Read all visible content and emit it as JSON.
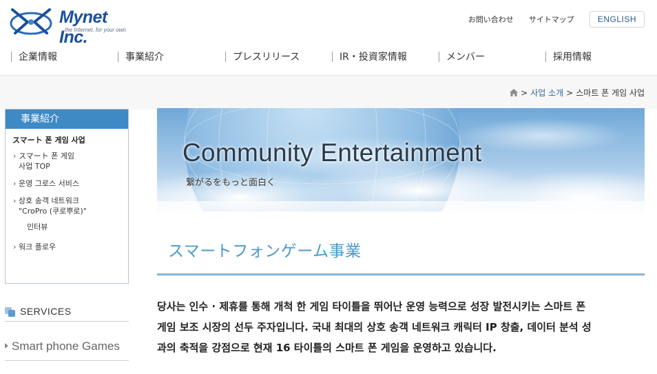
{
  "header": {
    "logo_name": "Mynet Inc.",
    "logo_tagline": "the Internet, for your own",
    "util_links": [
      "お問い合わせ",
      "サイトマップ"
    ],
    "language_button": "ENGLISH"
  },
  "gnav": [
    "企業情報",
    "事業紹介",
    "プレスリリース",
    "IR・投資家情報",
    "メンバー",
    "採用情報"
  ],
  "breadcrumb": {
    "sep": ">",
    "items": [
      "사업 소개",
      "스마트 폰 게임 사업"
    ]
  },
  "sidebar": {
    "heading": "事業紹介",
    "current": "スマート 폰 게임 사업",
    "items": [
      {
        "label_line1": "スマート 폰 게임",
        "label_line2": "사업 TOP"
      },
      {
        "label_line1": "운영 그로스 서비스"
      },
      {
        "label_line1": "상호 송객 네트워크",
        "label_line2": "\"CroPro (쿠로뿌로)\""
      },
      {
        "label_line1": "워크 플로우"
      }
    ],
    "sub_item": "인터뷰",
    "services_label": "SERVICES",
    "smartphone_games_label": "Smart phone Games"
  },
  "banner": {
    "title": "Community Entertainment",
    "subtitle": "繋がるをもっと面白く"
  },
  "main": {
    "heading": "スマートフォンゲーム事業",
    "lead_lines": [
      "당사는 인수 · 제휴를 통해 개척 한 게임 타이틀을 뛰어난 운영 능력으로 성장 발전시키는 스마트 폰",
      "게임 보조 시장의 선두 주자입니다. 국내 최대의 상호 송객 네트워크 캐릭터 IP 창출, 데이터 분석 성",
      "과의 축적을 강점으로 현재 16 타이틀의 스마트 폰 게임을 운영하고 있습니다."
    ]
  },
  "colors": {
    "brand": "#1a4f9c",
    "sidebar_head": "#3f89c4",
    "heading_blue": "#4a9ac9",
    "link": "#2a6aa8"
  }
}
